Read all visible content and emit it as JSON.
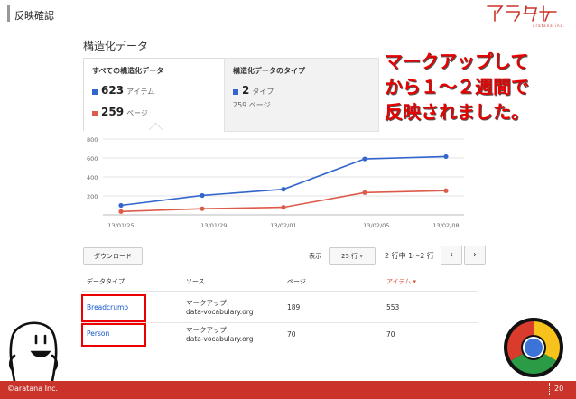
{
  "slide": {
    "title": "反映確認",
    "page_number": "20",
    "copyright": "©aratana Inc."
  },
  "logo": {
    "text": "アラタナ",
    "subtitle": "aratana inc.",
    "color": "#c9332a"
  },
  "panel": {
    "title": "構造化データ",
    "tab_all": {
      "label": "すべての構造化データ",
      "items_count": "623",
      "items_label": "アイテム",
      "pages_count": "259",
      "pages_label": "ページ"
    },
    "tab_types": {
      "label": "構造化データのタイプ",
      "types_count": "2",
      "types_label": "タイプ",
      "pages_text": "259 ページ"
    }
  },
  "callout": {
    "lines": [
      "マークアップして",
      "から１～２週間で",
      "反映されました。"
    ],
    "color": "#e60000"
  },
  "chart_data": {
    "type": "line",
    "x": [
      "13/01/25",
      "13/01/29",
      "13/02/01",
      "13/02/05",
      "13/02/08"
    ],
    "x_days": [
      0,
      4,
      7,
      11,
      14
    ],
    "yticks": [
      "800",
      "600",
      "400",
      "200"
    ],
    "ylim": [
      0,
      800
    ],
    "grid": true,
    "series": [
      {
        "color": "#3366cc",
        "points": [
          [
            0,
            100
          ],
          [
            3.5,
            205
          ],
          [
            7,
            270
          ],
          [
            10.5,
            590
          ],
          [
            14,
            615
          ]
        ]
      },
      {
        "color": "#dc5b4a",
        "points": [
          [
            0,
            35
          ],
          [
            3.5,
            65
          ],
          [
            7,
            80
          ],
          [
            10.5,
            235
          ],
          [
            14,
            255
          ]
        ]
      }
    ]
  },
  "controls": {
    "download": "ダウンロード",
    "show": "表示",
    "rows": "25 行",
    "pager": "2 行中 1〜2 行",
    "prev": "‹",
    "next": "›"
  },
  "table": {
    "headers": [
      "データタイプ",
      "ソース",
      "ページ",
      "アイテム"
    ],
    "rows": [
      {
        "type": "Breadcrumb",
        "source_1": "マークアップ:",
        "source_2": "data-vocabulary.org",
        "pages": "189",
        "items": "553"
      },
      {
        "type": "Person",
        "source_1": "マークアップ:",
        "source_2": "data-vocabulary.org",
        "pages": "70",
        "items": "70"
      }
    ]
  },
  "colors": {
    "blue": "#3366cc",
    "red": "#dc5b4a",
    "footer": "#c9332a"
  }
}
